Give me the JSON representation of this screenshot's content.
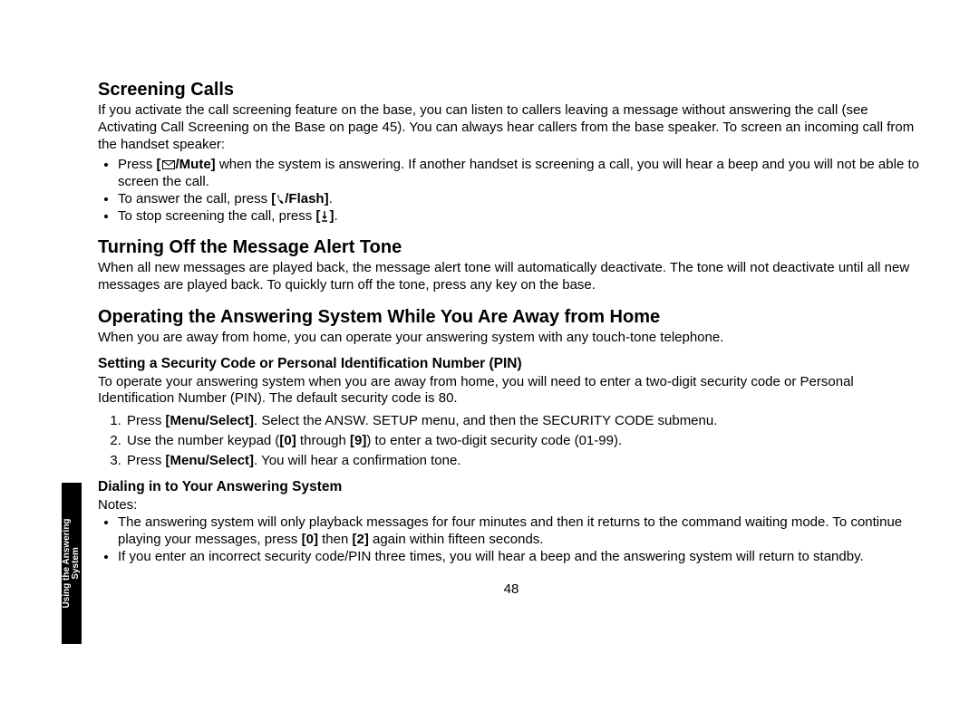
{
  "sideTab": "Using the Answering\nSystem",
  "pageNumber": "48",
  "sec1": {
    "heading": "Screening Calls",
    "intro": "If you activate the call screening feature on the base, you can listen to callers leaving a message without answering the call (see Activating Call Screening on the Base on page 45). You can always hear callers from the base speaker. To screen an incoming call from the handset speaker:",
    "b1a": "Press ",
    "b1_icon_label": "[",
    "b1_mute": "/Mute]",
    "b1b": " when the system is answering. If another handset is screening a call, you will hear a beep and you will not be able to screen the call.",
    "b2a": "To answer the call, press ",
    "b2_flash": "[ /Flash]",
    "b2b": ".",
    "b3a": "To stop screening the call, press ",
    "b3_btn": "[ ]",
    "b3b": "."
  },
  "sec2": {
    "heading": "Turning Off the Message Alert Tone",
    "body": "When all new messages are played back, the message alert tone will automatically deactivate. The tone will not deactivate until all new messages are played back. To quickly turn off the tone, press any key on the base."
  },
  "sec3": {
    "heading": "Operating the Answering System While You Are Away from Home",
    "intro": "When you are away from home, you can operate your answering system with any touch-tone telephone.",
    "sub1_heading": "Setting a Security Code or Personal Identification Number (PIN)",
    "sub1_body": "To operate your answering system when you are away from home, you will need to enter a two-digit security code or Personal Identification Number (PIN). The default security code is 80.",
    "s1a": "Press ",
    "s1_btn": "[Menu/Select]",
    "s1b": ". Select the ANSW. SETUP menu, and then the SECURITY CODE submenu.",
    "s2a": "Use the number keypad (",
    "s2_btn0": "[0]",
    "s2b": " through ",
    "s2_btn9": "[9]",
    "s2c": ") to enter a two-digit security code (01-99).",
    "s3a": "Press ",
    "s3_btn": "[Menu/Select]",
    "s3b": ". You will hear a confirmation tone.",
    "sub2_heading": "Dialing in to Your Answering System",
    "notes_label": "Notes:",
    "n1a": "The answering system will only playback messages for four minutes and then it returns to the command waiting mode. To continue playing your messages, press ",
    "n1_btn0": "[0]",
    "n1b": " then ",
    "n1_btn2": "[2]",
    "n1c": " again within fifteen seconds.",
    "n2": "If you enter an incorrect security code/PIN three times, you will hear a beep and the answering system will return to standby."
  }
}
